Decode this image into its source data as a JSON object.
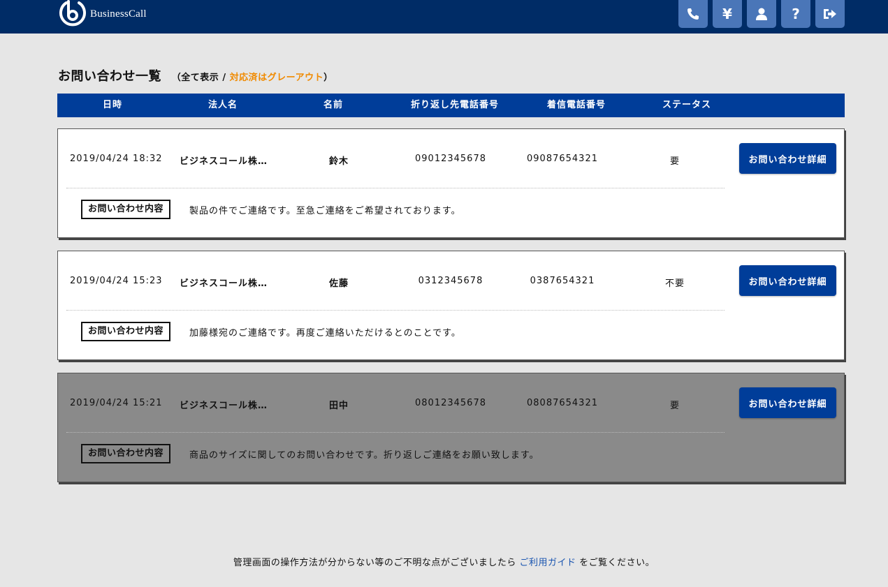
{
  "header": {
    "brand": "BusinessCall",
    "nav": [
      {
        "icon": "phone-icon"
      },
      {
        "icon": "yen-icon",
        "glyph": "¥"
      },
      {
        "icon": "user-icon"
      },
      {
        "icon": "help-icon",
        "glyph": "?"
      },
      {
        "icon": "logout-icon"
      }
    ]
  },
  "page": {
    "title": "お問い合わせ一覧",
    "sub_open": "（",
    "show_all": "全て表示",
    "slash": " / ",
    "grayed_note": "対応済はグレーアウト",
    "sub_close": "）"
  },
  "table": {
    "columns": [
      "日時",
      "法人名",
      "名前",
      "折り返し先電話番号",
      "着信電話番号",
      "ステータス"
    ]
  },
  "rows": [
    {
      "datetime": "2019/04/24 18:32",
      "company": "ビジネスコール株…",
      "name": "鈴木",
      "callback": "09012345678",
      "incoming": "09087654321",
      "status": "要",
      "inquiry_label": "お問い合わせ内容",
      "inquiry": "製品の件でご連絡です。至急ご連絡をご希望されております。",
      "detail_label": "お問い合わせ詳細",
      "grayed": false
    },
    {
      "datetime": "2019/04/24 15:23",
      "company": "ビジネスコール株…",
      "name": "佐藤",
      "callback": "0312345678",
      "incoming": "0387654321",
      "status": "不要",
      "inquiry_label": "お問い合わせ内容",
      "inquiry": "加藤様宛のご連絡です。再度ご連絡いただけるとのことです。",
      "detail_label": "お問い合わせ詳細",
      "grayed": false
    },
    {
      "datetime": "2019/04/24 15:21",
      "company": "ビジネスコール株…",
      "name": "田中",
      "callback": "08012345678",
      "incoming": "08087654321",
      "status": "要",
      "inquiry_label": "お問い合わせ内容",
      "inquiry": "商品のサイズに関してのお問い合わせです。折り返しご連絡をお願い致します。",
      "detail_label": "お問い合わせ詳細",
      "grayed": true
    }
  ],
  "footer": {
    "pre": "管理画面の操作方法が分からない等のご不明な点がございましたら ",
    "link": "ご利用ガイド",
    "post": " をご覧ください。"
  },
  "colors": {
    "header_bg": "#002c66",
    "nav_button": "#4a76b8",
    "table_header": "#003d99",
    "accent_orange": "#f08a00",
    "grayed_row": "#8a8a8a"
  }
}
